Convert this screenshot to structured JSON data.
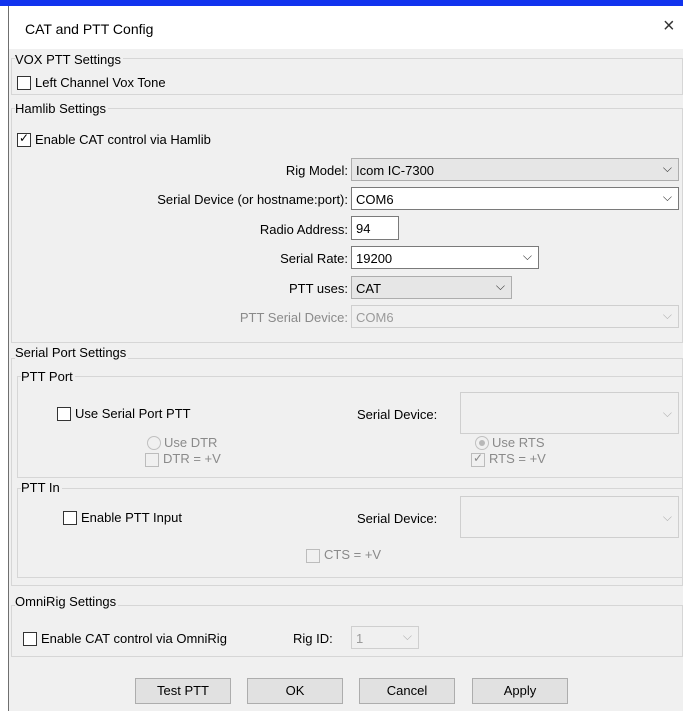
{
  "window": {
    "title": "CAT and PTT Config",
    "close_glyph": "×"
  },
  "vox": {
    "group_label": "VOX PTT Settings",
    "left_channel_label": "Left Channel Vox Tone",
    "left_channel_checked": false
  },
  "hamlib": {
    "group_label": "Hamlib Settings",
    "enable_label": "Enable CAT control via Hamlib",
    "enable_checked": true,
    "rig_model_label": "Rig Model:",
    "rig_model_value": "Icom IC-7300",
    "serial_device_label": "Serial Device (or hostname:port):",
    "serial_device_value": "COM6",
    "radio_address_label": "Radio Address:",
    "radio_address_value": "94",
    "serial_rate_label": "Serial Rate:",
    "serial_rate_value": "19200",
    "ptt_uses_label": "PTT uses:",
    "ptt_uses_value": "CAT",
    "ptt_serial_device_label": "PTT Serial Device:",
    "ptt_serial_device_value": "COM6"
  },
  "serial_port": {
    "group_label": "Serial Port Settings",
    "ptt_port": {
      "group_label": "PTT Port",
      "use_serial_label": "Use Serial Port PTT",
      "use_serial_checked": false,
      "serial_device_label": "Serial Device:",
      "serial_device_value": "",
      "use_dtr_label": "Use DTR",
      "dtr_label": "DTR = +V",
      "use_rts_label": "Use RTS",
      "use_rts_selected": true,
      "rts_label": "RTS = +V",
      "rts_checked": true
    },
    "ptt_in": {
      "group_label": "PTT In",
      "enable_label": "Enable PTT Input",
      "enable_checked": false,
      "serial_device_label": "Serial Device:",
      "serial_device_value": "",
      "cts_label": "CTS = +V"
    }
  },
  "omnirig": {
    "group_label": "OmniRig Settings",
    "enable_label": "Enable CAT control via OmniRig",
    "enable_checked": false,
    "rig_id_label": "Rig ID:",
    "rig_id_value": "1"
  },
  "buttons": {
    "test_ptt": "Test PTT",
    "ok": "OK",
    "cancel": "Cancel",
    "apply": "Apply"
  },
  "glyphs": {
    "check": "✓",
    "chevron": "⌵"
  }
}
